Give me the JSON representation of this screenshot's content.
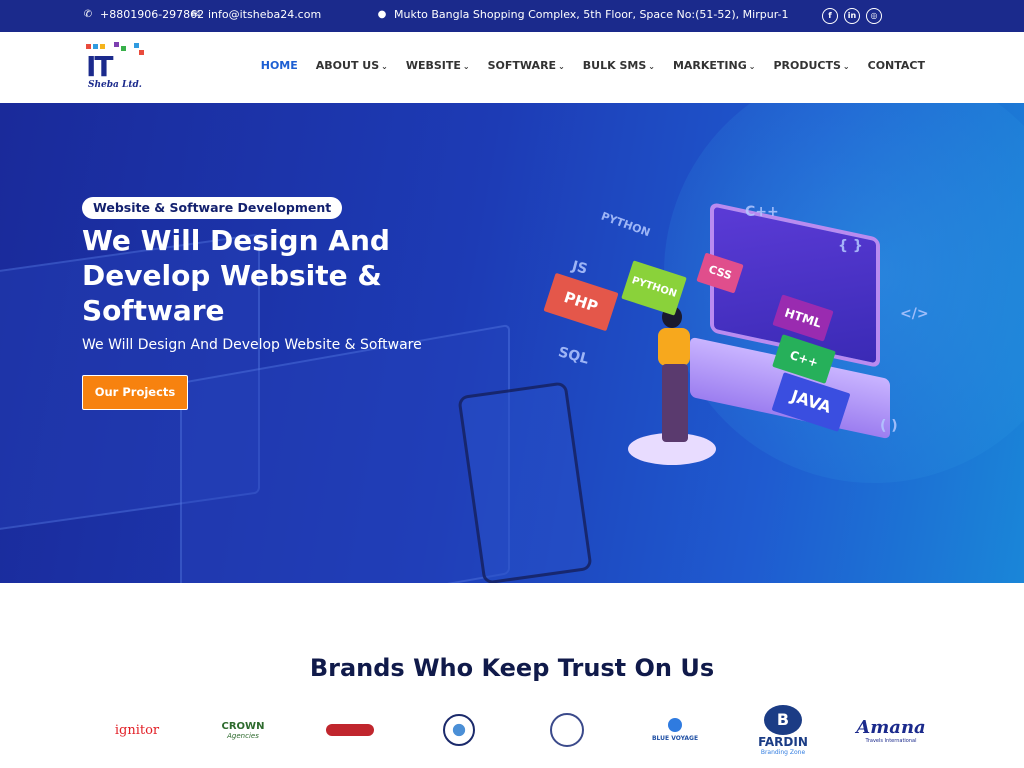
{
  "topbar": {
    "phone": "+8801906-297862",
    "email": "info@itsheba24.com",
    "address": "Mukto Bangla Shopping Complex, 5th Floor, Space No:(51-52), Mirpur-1",
    "social": [
      {
        "icon": "facebook-icon",
        "glyph": "f"
      },
      {
        "icon": "linkedin-icon",
        "glyph": "in"
      },
      {
        "icon": "instagram-icon",
        "glyph": "◎"
      }
    ]
  },
  "nav": {
    "logo_text": "IT",
    "logo_sub": "Sheba Ltd.",
    "items": [
      {
        "label": "HOME",
        "active": true,
        "dropdown": false
      },
      {
        "label": "ABOUT US",
        "active": false,
        "dropdown": true
      },
      {
        "label": "WEBSITE",
        "active": false,
        "dropdown": true
      },
      {
        "label": "SOFTWARE",
        "active": false,
        "dropdown": true
      },
      {
        "label": "BULK SMS",
        "active": false,
        "dropdown": true
      },
      {
        "label": "MARKETING",
        "active": false,
        "dropdown": true
      },
      {
        "label": "PRODUCTS",
        "active": false,
        "dropdown": true
      },
      {
        "label": "CONTACT",
        "active": false,
        "dropdown": false
      }
    ]
  },
  "hero": {
    "badge": "Website & Software Development",
    "title": "We Will Design And Develop Website & Software",
    "subtitle": "We Will Design And Develop Website & Software",
    "cta": "Our Projects",
    "tags": {
      "php": "PHP",
      "python": "PYTHON",
      "css": "CSS",
      "html": "HTML",
      "cpp": "C++",
      "java": "JAVA",
      "js": "JS",
      "sql": "SQL",
      "python_float": "PYTHON",
      "cpp_float": "C++",
      "braces": "{ }",
      "angle": "</>",
      "parens": "( )"
    }
  },
  "brands": {
    "title": "Brands Who Keep Trust On Us",
    "logos": [
      {
        "name": "ignitor",
        "text": "ignitor",
        "color": "#e21f26"
      },
      {
        "name": "crown",
        "text": "CROWN",
        "sub": "Agencies",
        "color": "#2d6a2d"
      },
      {
        "name": "foundation",
        "text": "",
        "color": "#c0262d"
      },
      {
        "name": "emblem-1",
        "text": "",
        "color": "#1b2a6b"
      },
      {
        "name": "emblem-2",
        "text": "",
        "color": "#3b4a8b"
      },
      {
        "name": "blue-voyage",
        "text": "BLUE VOYAGE",
        "color": "#1f4fa3"
      },
      {
        "name": "fardin",
        "text": "FARDIN",
        "sub": "Branding Zone",
        "color": "#1b3c85"
      },
      {
        "name": "amana",
        "text": "Amana",
        "sub": "Travels International",
        "color": "#1b2a8c"
      }
    ]
  },
  "colors": {
    "topbar": "#1b2a8c",
    "accent": "#1d5fd3",
    "cta": "#f7820f",
    "title": "#101a4a"
  }
}
